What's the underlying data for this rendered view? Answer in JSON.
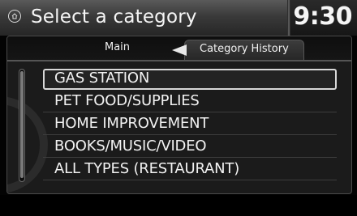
{
  "header": {
    "title": "Select a category",
    "clock": "9:30",
    "home_icon": "home-icon"
  },
  "tabs": [
    {
      "label": "Main"
    },
    {
      "label": "Category History",
      "active": true
    }
  ],
  "list": {
    "items": [
      {
        "label": "GAS STATION",
        "selected": true
      },
      {
        "label": "PET FOOD/SUPPLIES"
      },
      {
        "label": "HOME IMPROVEMENT"
      },
      {
        "label": "BOOKS/MUSIC/VIDEO"
      },
      {
        "label": "ALL TYPES (RESTAURANT)"
      }
    ]
  }
}
